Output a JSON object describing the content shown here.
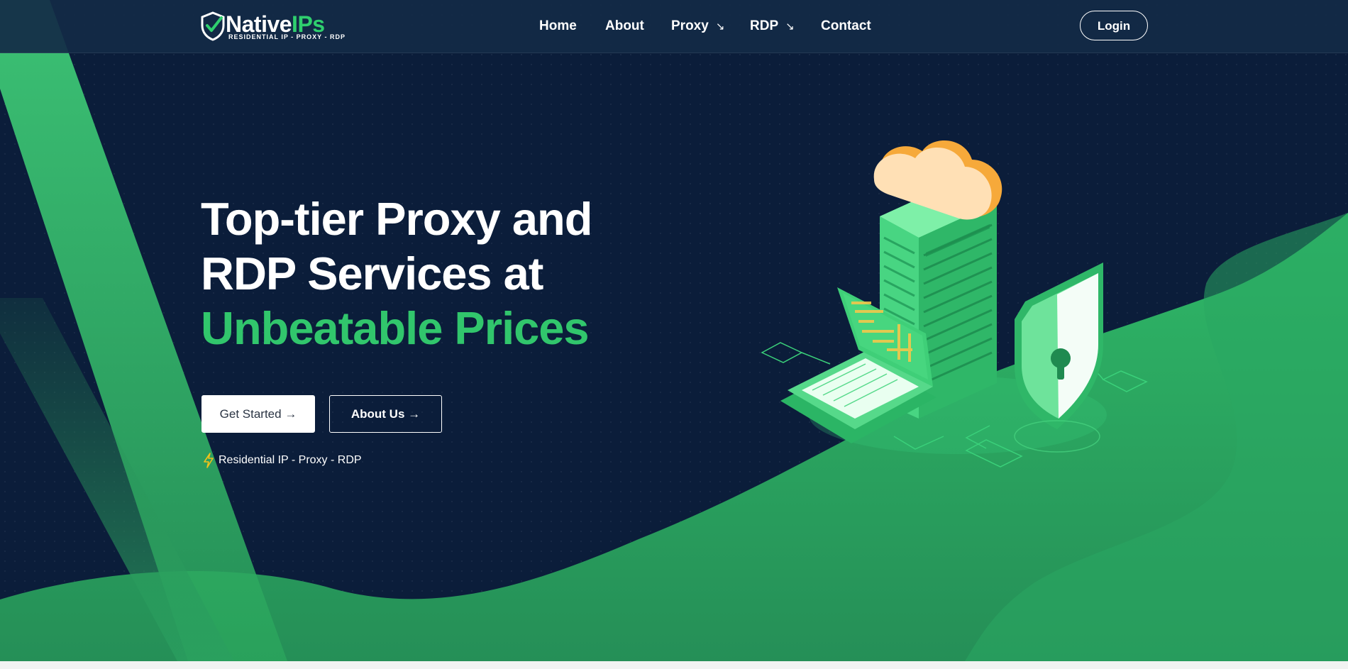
{
  "brand": {
    "name_part1": "Native",
    "name_part2": "IPs",
    "tagline": "RESIDENTIAL IP - PROXY - RDP",
    "logo_icon": "shield-check-icon"
  },
  "nav": {
    "items": [
      {
        "label": "Home"
      },
      {
        "label": "About"
      },
      {
        "label": "Proxy",
        "arrow": "↘"
      },
      {
        "label": "RDP",
        "arrow": "↘"
      },
      {
        "label": "Contact"
      }
    ],
    "login_label": "Login"
  },
  "hero": {
    "headline_line1": "Top-tier Proxy and",
    "headline_line2": "RDP Services at",
    "headline_accent": "Unbeatable Prices",
    "primary_button": "Get Started →",
    "secondary_button": "About Us →",
    "tagline": "Residential IP - Proxy - RDP",
    "tagline_icon": "lightning-bolt-icon"
  },
  "colors": {
    "background": "#0b1d3a",
    "accent": "#31c66c",
    "header": "#142a46"
  }
}
